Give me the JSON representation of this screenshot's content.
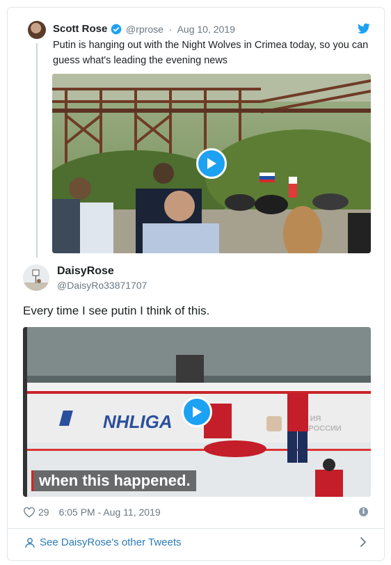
{
  "quoted": {
    "name": "Scott Rose",
    "handle": "@rprose",
    "separator": "·",
    "date": "Aug 10, 2019",
    "text": "Putin is hanging out with the Night Wolves in Crimea today, so you can guess what's leading the evening news"
  },
  "reply": {
    "name": "DaisyRose",
    "handle": "@DaisyRo33871707",
    "text": "Every time I see putin I think of this.",
    "video_caption": "when this happened.",
    "rink_banner": "NHLIGA",
    "rink_banner_right": "ФЕД  ИЯ\nХОК  РОССИИ"
  },
  "footer": {
    "likes": "29",
    "timestamp": "6:05 PM - Aug 11, 2019",
    "more_link": "See DaisyRose's other Tweets"
  },
  "colors": {
    "brand_blue": "#1da1f2",
    "link_blue": "#2b7bb9",
    "muted": "#697882",
    "border": "#e1e8ed"
  },
  "icons": [
    "verified-badge-icon",
    "twitter-bird-icon",
    "play-icon",
    "heart-icon",
    "info-icon",
    "person-icon",
    "chevron-right-icon"
  ]
}
